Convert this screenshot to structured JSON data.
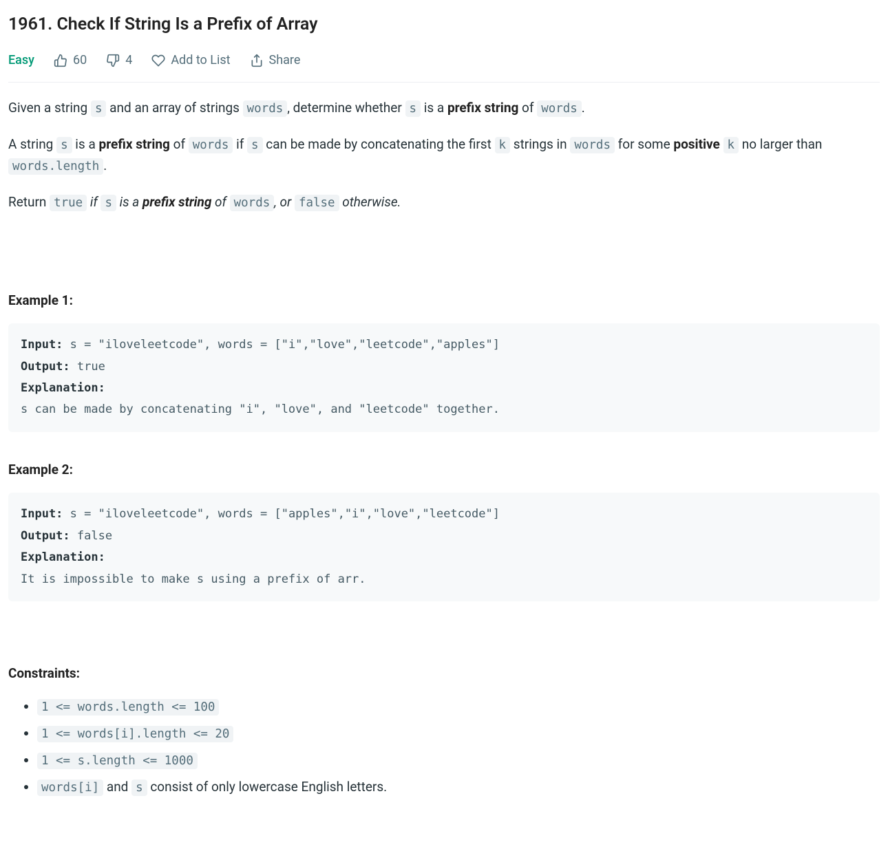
{
  "title": "1961. Check If String Is a Prefix of Array",
  "meta": {
    "difficulty": "Easy",
    "likes": "60",
    "dislikes": "4",
    "addToList": "Add to List",
    "share": "Share"
  },
  "description": {
    "p1": {
      "t1": "Given a string ",
      "c1": "s",
      "t2": " and an array of strings ",
      "c2": "words",
      "t3": ", determine whether ",
      "c3": "s",
      "t4": " is a ",
      "b1": "prefix string",
      "t5": " of ",
      "c4": "words",
      "t6": "."
    },
    "p2": {
      "t1": "A string ",
      "c1": "s",
      "t2": " is a ",
      "b1": "prefix string",
      "t3": " of ",
      "c2": "words",
      "t4": " if ",
      "c3": "s",
      "t5": " can be made by concatenating the first ",
      "c4": "k",
      "t6": " strings in ",
      "c5": "words",
      "t7": " for some ",
      "b2": "positive",
      "t8": " ",
      "c6": "k",
      "t9": " no larger than ",
      "c7": "words.length",
      "t10": "."
    },
    "p3": {
      "t1": "Return ",
      "c1": "true",
      "i1": " if ",
      "c2": "s",
      "i2": " is a ",
      "bi1": "prefix string",
      "i3": " of ",
      "c3": "words",
      "i4": ", or ",
      "c4": "false",
      "i5": " otherwise.",
      "t2": ""
    }
  },
  "example1": {
    "heading": "Example 1:",
    "inputLabel": "Input:",
    "input": " s = \"iloveleetcode\", words = [\"i\",\"love\",\"leetcode\",\"apples\"]",
    "outputLabel": "Output:",
    "output": " true",
    "explLabel": "Explanation:",
    "expl": "s can be made by concatenating \"i\", \"love\", and \"leetcode\" together."
  },
  "example2": {
    "heading": "Example 2:",
    "inputLabel": "Input:",
    "input": " s = \"iloveleetcode\", words = [\"apples\",\"i\",\"love\",\"leetcode\"]",
    "outputLabel": "Output:",
    "output": " false",
    "explLabel": "Explanation:",
    "expl": "It is impossible to make s using a prefix of arr."
  },
  "constraints": {
    "heading": "Constraints:",
    "c1": "1 <= words.length <= 100",
    "c2": "1 <= words[i].length <= 20",
    "c3": "1 <= s.length <= 1000",
    "c4a": "words[i]",
    "c4b": " and ",
    "c4c": "s",
    "c4d": " consist of only lowercase English letters."
  }
}
